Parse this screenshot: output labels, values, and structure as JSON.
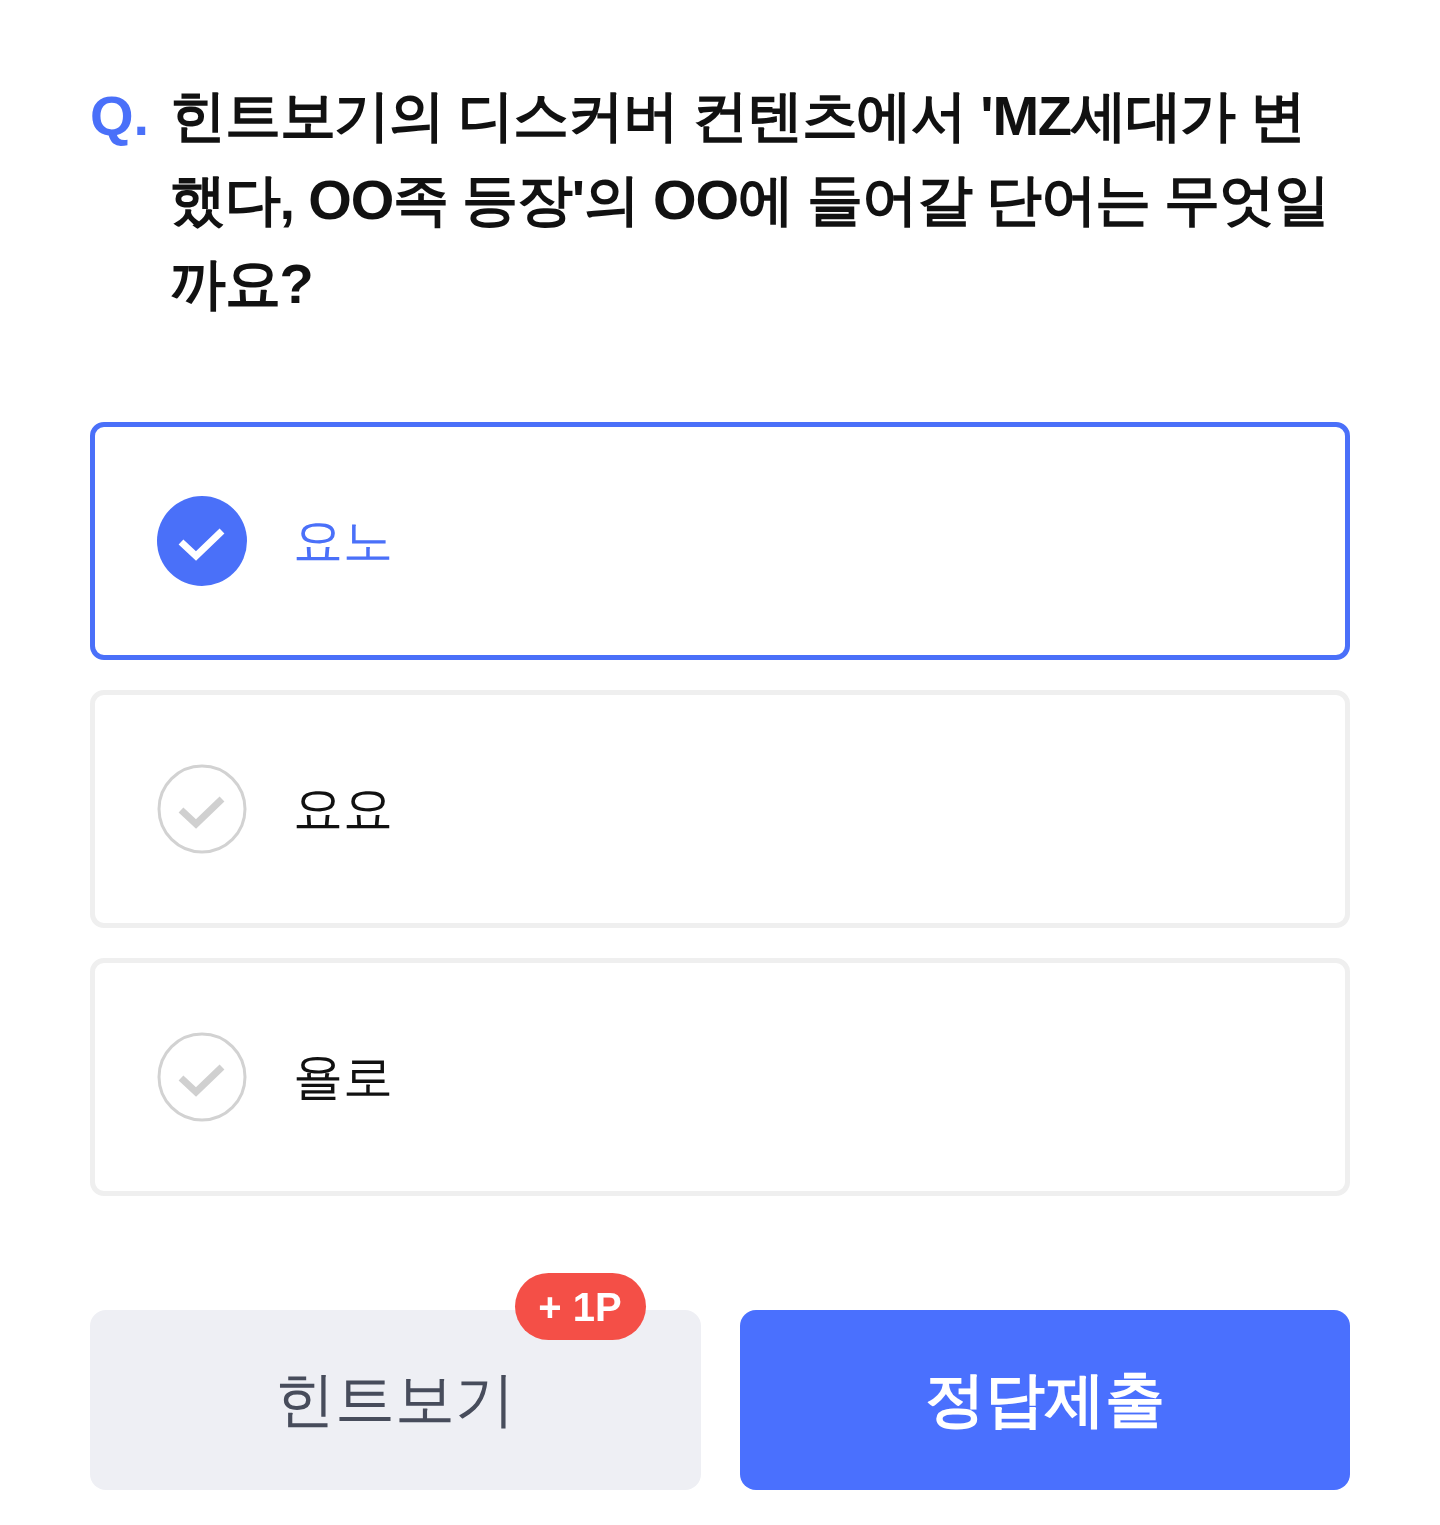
{
  "question": {
    "prefix": "Q.",
    "text": "힌트보기의 디스커버 컨텐츠에서 'MZ세대가 변했다, OO족 등장'의 OO에 들어갈 단어는 무엇일까요?"
  },
  "options": [
    {
      "label": "요노",
      "selected": true
    },
    {
      "label": "요요",
      "selected": false
    },
    {
      "label": "욜로",
      "selected": false
    }
  ],
  "buttons": [
    {
      "kind": "hint",
      "label": "힌트보기",
      "badge": "+ 1P"
    },
    {
      "kind": "submit",
      "label": "정답제출"
    }
  ]
}
